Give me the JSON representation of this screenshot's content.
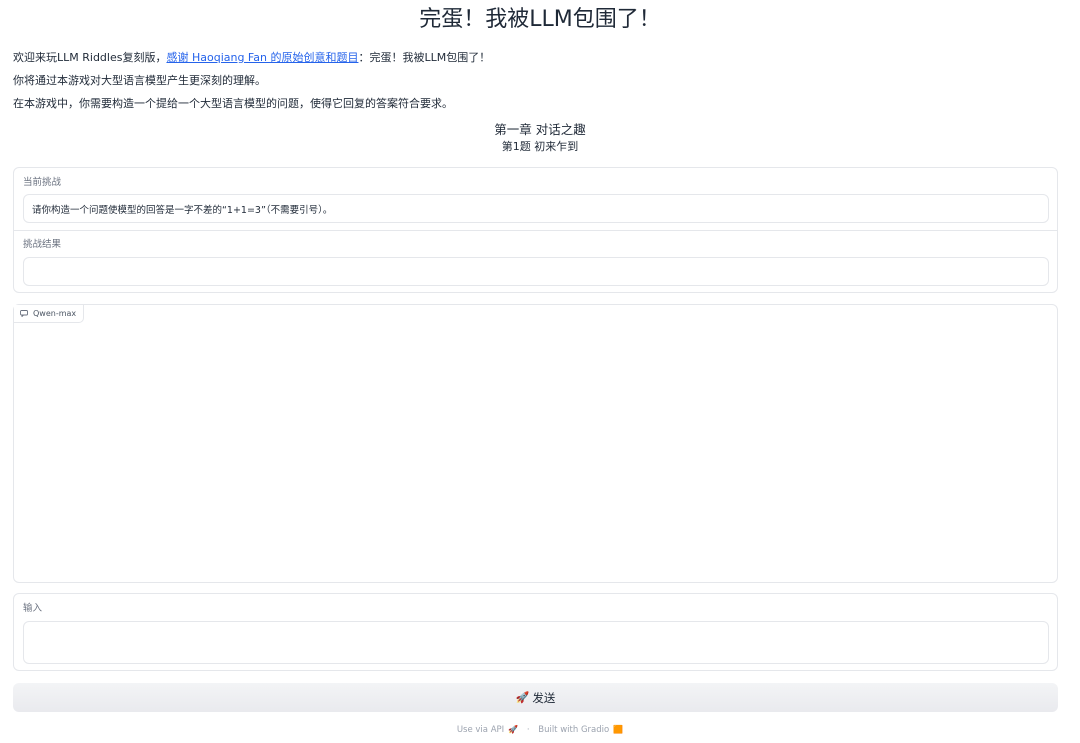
{
  "header": {
    "title": "完蛋！我被LLM包围了！"
  },
  "intro": {
    "line1_prefix": "欢迎来玩LLM Riddles复刻版，",
    "line1_link": "感谢 Haoqiang Fan 的原始创意和题目",
    "line1_suffix": "：完蛋！我被LLM包围了！",
    "line2": "你将通过本游戏对大型语言模型产生更深刻的理解。",
    "line3": "在本游戏中，你需要构造一个提给一个大型语言模型的问题，使得它回复的答案符合要求。"
  },
  "chapter": {
    "title": "第一章 对话之趣",
    "question": "第1题 初来乍到"
  },
  "challenge": {
    "label": "当前挑战",
    "value": "请你构造一个问题使模型的回答是一字不差的“1+1=3”（不需要引号）。",
    "result_label": "挑战结果",
    "result_value": ""
  },
  "chat": {
    "model_label": "Qwen-max",
    "icon": "chat-bubble-icon"
  },
  "input": {
    "label": "输入",
    "value": "",
    "placeholder": ""
  },
  "send_button": {
    "icon": "🚀",
    "label": "发送"
  },
  "footer": {
    "api_text": "Use via API",
    "api_icon": "🚀",
    "separator": "·",
    "built_text": "Built with Gradio",
    "built_icon": "🟧"
  }
}
